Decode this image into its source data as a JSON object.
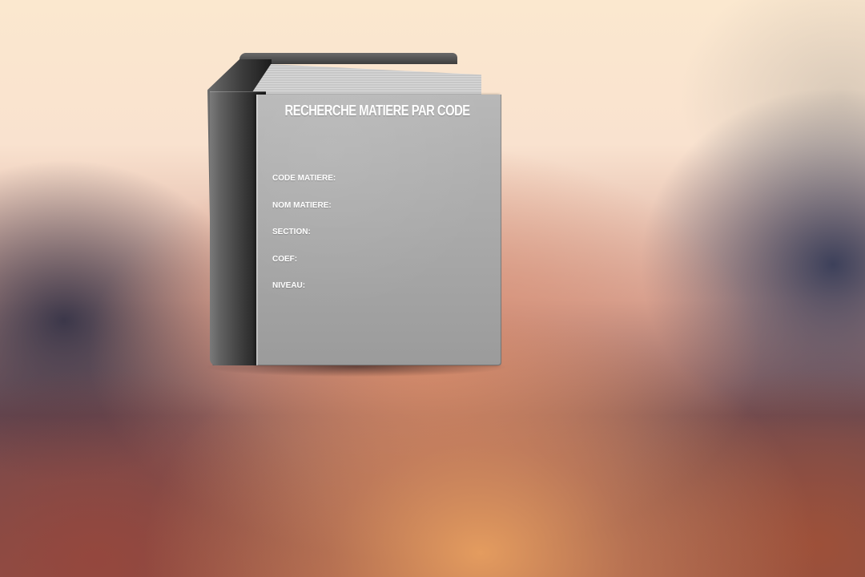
{
  "title": "RECHERCHE MATIERE  PAR CODE",
  "fields": [
    {
      "label": "CODE MATIERE:",
      "value": ""
    },
    {
      "label": "NOM MATIERE:",
      "value": ""
    },
    {
      "label": "SECTION:",
      "value": ""
    },
    {
      "label": "COEF:",
      "value": ""
    },
    {
      "label": "NIVEAU:",
      "value": ""
    }
  ]
}
